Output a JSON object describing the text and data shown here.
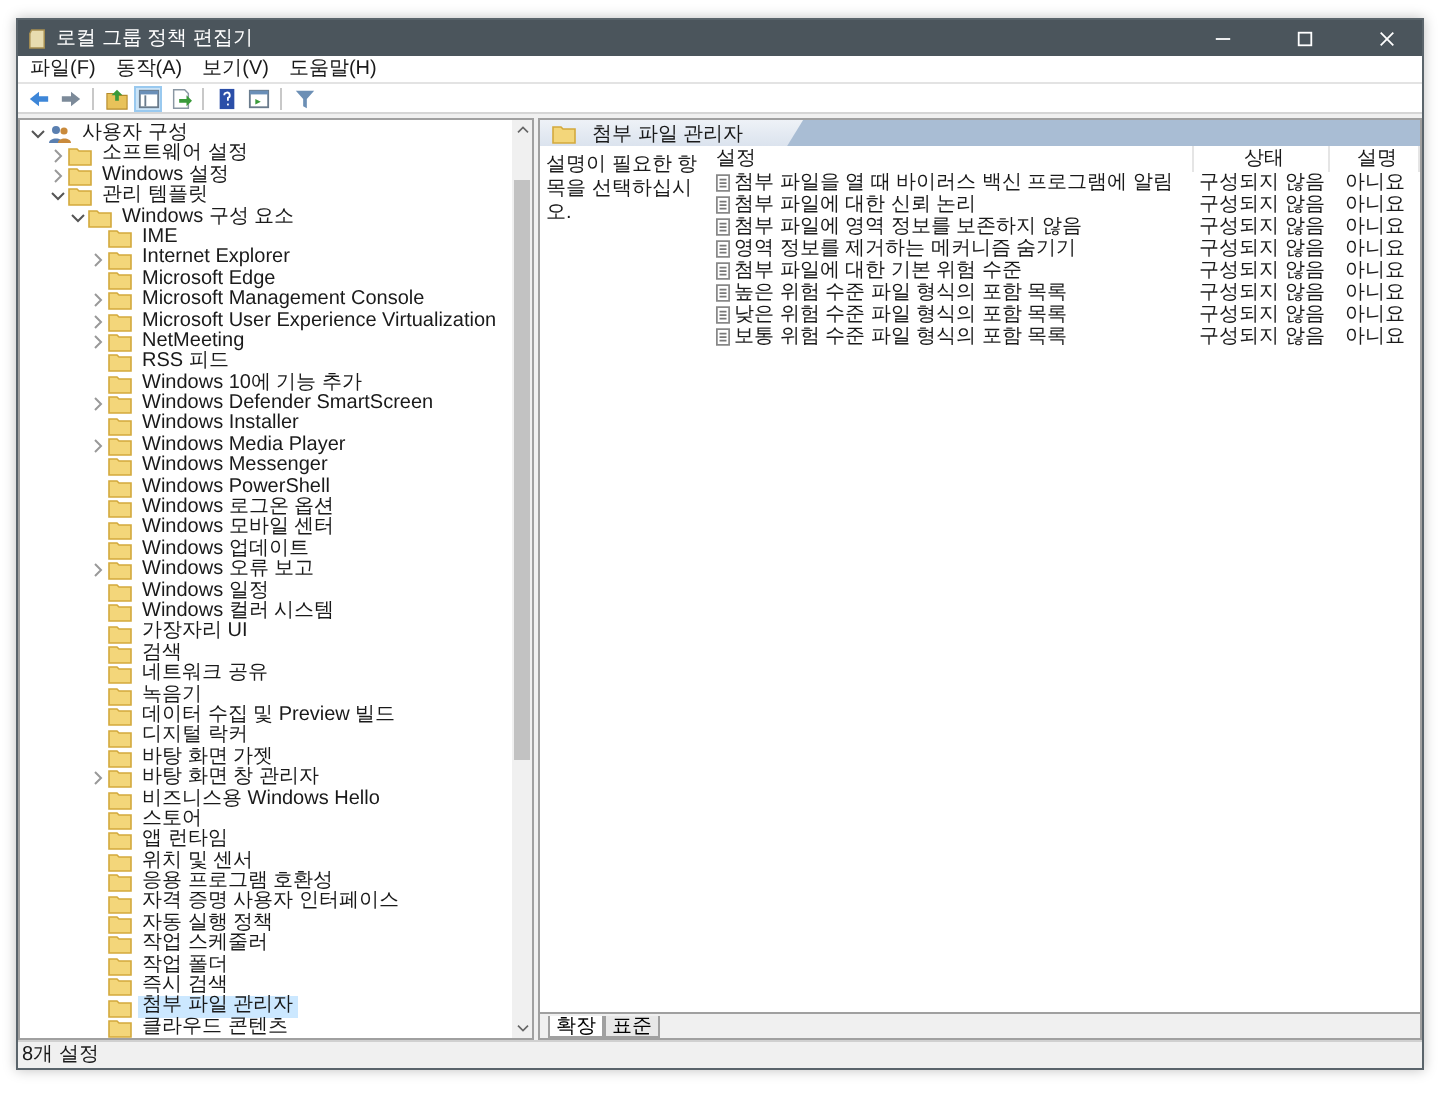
{
  "window": {
    "title": "로컬 그룹 정책 편집기"
  },
  "menu": [
    "파일(F)",
    "동작(A)",
    "보기(V)",
    "도움말(H)"
  ],
  "toolbar_buttons": [
    {
      "kind": "back",
      "pressed": false
    },
    {
      "kind": "forward",
      "pressed": false
    },
    {
      "kind": "up",
      "pressed": false
    },
    {
      "kind": "tree",
      "pressed": true
    },
    {
      "kind": "export",
      "pressed": false
    },
    {
      "kind": "help",
      "pressed": false
    },
    {
      "kind": "pane",
      "pressed": false
    },
    {
      "kind": "filter",
      "pressed": false
    }
  ],
  "tree": {
    "items": [
      {
        "label": "사용자 구성",
        "kind": "user",
        "expandable": true,
        "expanded": true,
        "selected": false,
        "children": [
          {
            "label": "소프트웨어 설정",
            "kind": "folder",
            "expandable": true,
            "expanded": false,
            "selected": false
          },
          {
            "label": "Windows 설정",
            "kind": "folder",
            "expandable": true,
            "expanded": false,
            "selected": false
          },
          {
            "label": "관리 템플릿",
            "kind": "folder",
            "expandable": true,
            "expanded": true,
            "selected": false,
            "children": [
              {
                "label": "Windows 구성 요소",
                "kind": "folder",
                "expandable": true,
                "expanded": true,
                "selected": false,
                "children": [
                  {
                    "label": "IME",
                    "kind": "folder",
                    "expandable": false,
                    "expanded": false,
                    "selected": false
                  },
                  {
                    "label": "Internet Explorer",
                    "kind": "folder",
                    "expandable": true,
                    "expanded": false,
                    "selected": false
                  },
                  {
                    "label": "Microsoft Edge",
                    "kind": "folder",
                    "expandable": false,
                    "expanded": false,
                    "selected": false
                  },
                  {
                    "label": "Microsoft Management Console",
                    "kind": "folder",
                    "expandable": true,
                    "expanded": false,
                    "selected": false
                  },
                  {
                    "label": "Microsoft User Experience Virtualization",
                    "kind": "folder",
                    "expandable": true,
                    "expanded": false,
                    "selected": false
                  },
                  {
                    "label": "NetMeeting",
                    "kind": "folder",
                    "expandable": true,
                    "expanded": false,
                    "selected": false
                  },
                  {
                    "label": "RSS 피드",
                    "kind": "folder",
                    "expandable": false,
                    "expanded": false,
                    "selected": false
                  },
                  {
                    "label": "Windows 10에 기능 추가",
                    "kind": "folder",
                    "expandable": false,
                    "expanded": false,
                    "selected": false
                  },
                  {
                    "label": "Windows Defender SmartScreen",
                    "kind": "folder",
                    "expandable": true,
                    "expanded": false,
                    "selected": false
                  },
                  {
                    "label": "Windows Installer",
                    "kind": "folder",
                    "expandable": false,
                    "expanded": false,
                    "selected": false
                  },
                  {
                    "label": "Windows Media Player",
                    "kind": "folder",
                    "expandable": true,
                    "expanded": false,
                    "selected": false
                  },
                  {
                    "label": "Windows Messenger",
                    "kind": "folder",
                    "expandable": false,
                    "expanded": false,
                    "selected": false
                  },
                  {
                    "label": "Windows PowerShell",
                    "kind": "folder",
                    "expandable": false,
                    "expanded": false,
                    "selected": false
                  },
                  {
                    "label": "Windows 로그온 옵션",
                    "kind": "folder",
                    "expandable": false,
                    "expanded": false,
                    "selected": false
                  },
                  {
                    "label": "Windows 모바일 센터",
                    "kind": "folder",
                    "expandable": false,
                    "expanded": false,
                    "selected": false
                  },
                  {
                    "label": "Windows 업데이트",
                    "kind": "folder",
                    "expandable": false,
                    "expanded": false,
                    "selected": false
                  },
                  {
                    "label": "Windows 오류 보고",
                    "kind": "folder",
                    "expandable": true,
                    "expanded": false,
                    "selected": false
                  },
                  {
                    "label": "Windows 일정",
                    "kind": "folder",
                    "expandable": false,
                    "expanded": false,
                    "selected": false
                  },
                  {
                    "label": "Windows 컬러 시스템",
                    "kind": "folder",
                    "expandable": false,
                    "expanded": false,
                    "selected": false
                  },
                  {
                    "label": "가장자리 UI",
                    "kind": "folder",
                    "expandable": false,
                    "expanded": false,
                    "selected": false
                  },
                  {
                    "label": "검색",
                    "kind": "folder",
                    "expandable": false,
                    "expanded": false,
                    "selected": false
                  },
                  {
                    "label": "네트워크 공유",
                    "kind": "folder",
                    "expandable": false,
                    "expanded": false,
                    "selected": false
                  },
                  {
                    "label": "녹음기",
                    "kind": "folder",
                    "expandable": false,
                    "expanded": false,
                    "selected": false
                  },
                  {
                    "label": "데이터 수집 및 Preview 빌드",
                    "kind": "folder",
                    "expandable": false,
                    "expanded": false,
                    "selected": false
                  },
                  {
                    "label": "디지털 락커",
                    "kind": "folder",
                    "expandable": false,
                    "expanded": false,
                    "selected": false
                  },
                  {
                    "label": "바탕 화면 가젯",
                    "kind": "folder",
                    "expandable": false,
                    "expanded": false,
                    "selected": false
                  },
                  {
                    "label": "바탕 화면 창 관리자",
                    "kind": "folder",
                    "expandable": true,
                    "expanded": false,
                    "selected": false
                  },
                  {
                    "label": "비즈니스용 Windows Hello",
                    "kind": "folder",
                    "expandable": false,
                    "expanded": false,
                    "selected": false
                  },
                  {
                    "label": "스토어",
                    "kind": "folder",
                    "expandable": false,
                    "expanded": false,
                    "selected": false
                  },
                  {
                    "label": "앱 런타임",
                    "kind": "folder",
                    "expandable": false,
                    "expanded": false,
                    "selected": false
                  },
                  {
                    "label": "위치 및 센서",
                    "kind": "folder",
                    "expandable": false,
                    "expanded": false,
                    "selected": false
                  },
                  {
                    "label": "응용 프로그램 호환성",
                    "kind": "folder",
                    "expandable": false,
                    "expanded": false,
                    "selected": false
                  },
                  {
                    "label": "자격 증명 사용자 인터페이스",
                    "kind": "folder",
                    "expandable": false,
                    "expanded": false,
                    "selected": false
                  },
                  {
                    "label": "자동 실행 정책",
                    "kind": "folder",
                    "expandable": false,
                    "expanded": false,
                    "selected": false
                  },
                  {
                    "label": "작업 스케줄러",
                    "kind": "folder",
                    "expandable": false,
                    "expanded": false,
                    "selected": false
                  },
                  {
                    "label": "작업 폴더",
                    "kind": "folder",
                    "expandable": false,
                    "expanded": false,
                    "selected": false
                  },
                  {
                    "label": "즉시 검색",
                    "kind": "folder",
                    "expandable": false,
                    "expanded": false,
                    "selected": false
                  },
                  {
                    "label": "첨부 파일 관리자",
                    "kind": "folder",
                    "expandable": false,
                    "expanded": false,
                    "selected": true
                  },
                  {
                    "label": "클라우드 콘텐츠",
                    "kind": "folder",
                    "expandable": false,
                    "expanded": false,
                    "selected": false
                  }
                ]
              }
            ]
          }
        ]
      }
    ]
  },
  "header": {
    "title": "첨부 파일 관리자"
  },
  "description": {
    "text": "설명이 필요한 항목을 선택하십시오."
  },
  "table": {
    "columns": [
      "설정",
      "상태",
      "설명"
    ],
    "rows": [
      {
        "setting": "첨부 파일을 열 때 바이러스 백신 프로그램에 알림",
        "state": "구성되지 않음",
        "comment": "아니요"
      },
      {
        "setting": "첨부 파일에 대한 신뢰 논리",
        "state": "구성되지 않음",
        "comment": "아니요"
      },
      {
        "setting": "첨부 파일에 영역 정보를 보존하지 않음",
        "state": "구성되지 않음",
        "comment": "아니요"
      },
      {
        "setting": "영역 정보를 제거하는 메커니즘 숨기기",
        "state": "구성되지 않음",
        "comment": "아니요"
      },
      {
        "setting": "첨부 파일에 대한 기본 위험 수준",
        "state": "구성되지 않음",
        "comment": "아니요"
      },
      {
        "setting": "높은 위험 수준 파일 형식의 포함 목록",
        "state": "구성되지 않음",
        "comment": "아니요"
      },
      {
        "setting": "낮은 위험 수준 파일 형식의 포함 목록",
        "state": "구성되지 않음",
        "comment": "아니요"
      },
      {
        "setting": "보통 위험 수준 파일 형식의 포함 목록",
        "state": "구성되지 않음",
        "comment": "아니요"
      }
    ]
  },
  "bottom_tabs": [
    {
      "label": "확장",
      "selected": true
    },
    {
      "label": "표준",
      "selected": false
    }
  ],
  "status_bar": {
    "text": "8개 설정"
  }
}
